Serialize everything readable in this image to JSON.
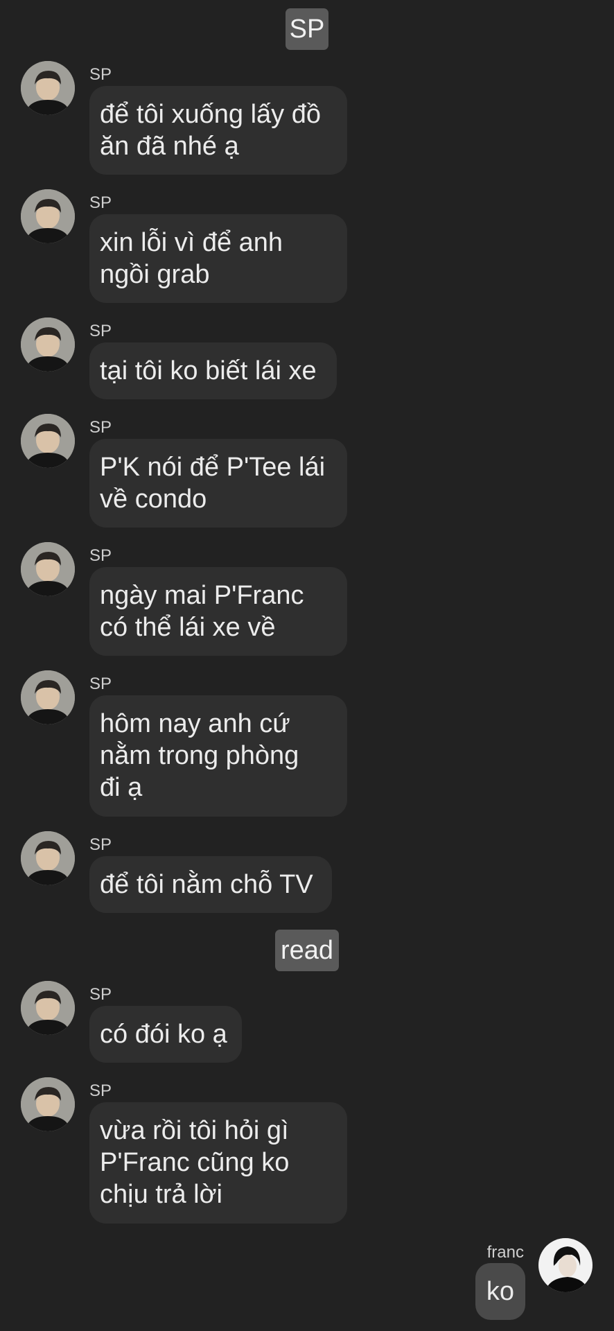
{
  "header": {
    "sender_pill": "SP"
  },
  "divider": {
    "read_label": "read"
  },
  "messages": [
    {
      "sender": "SP",
      "text": "để tôi xuống lấy đồ\năn đã nhé ạ"
    },
    {
      "sender": "SP",
      "text": "xin lỗi vì để anh\nngồi grab"
    },
    {
      "sender": "SP",
      "text": "tại tôi ko biết lái xe"
    },
    {
      "sender": "SP",
      "text": "P'K nói để P'Tee lái\nvề condo"
    },
    {
      "sender": "SP",
      "text": "ngày mai P'Franc\ncó thể lái xe về"
    },
    {
      "sender": "SP",
      "text": "hôm nay anh cứ\nnằm trong phòng\nđi ạ"
    },
    {
      "sender": "SP",
      "text": "để tôi nằm chỗ TV"
    },
    {
      "sender": "SP",
      "text": "có đói ko ạ"
    },
    {
      "sender": "SP",
      "text": "vừa rồi tôi hỏi gì\nP'Franc cũng ko\nchịu trả lời"
    }
  ],
  "reply": {
    "sender": "franc",
    "text": "ko"
  },
  "colors": {
    "background": "#222222",
    "bubble": "#2f2f2f",
    "pill": "#5a5a5a",
    "own_bubble": "#4a4a4a"
  }
}
